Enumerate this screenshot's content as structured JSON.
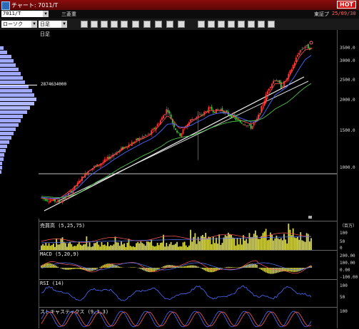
{
  "window": {
    "title": "チャート: 7011/T",
    "hot_badge": "HOT"
  },
  "stock": {
    "code": "7011/T",
    "name": "三菱重",
    "market": "東証プ",
    "date": "25/09/30"
  },
  "toolbar": {
    "chart_style": "ローソク",
    "period": "日足",
    "icons": [
      "zoom-icon",
      "list-icon",
      "print-icon",
      "draw-icon",
      "save-icon",
      "settings-icon",
      "grid-icon",
      "window-icon",
      "arrow-left-icon",
      "cross-icon",
      "tool1-icon",
      "tool2-icon",
      "tool3-icon",
      "tool4-icon",
      "tool5-icon",
      "tool6-icon",
      "tool7-icon",
      "tool8-icon"
    ]
  },
  "main": {
    "period_label": "日足",
    "volume_profile_marker": "2874634000"
  },
  "axis": {
    "main": [
      "3500.0",
      "3000.0",
      "2500.0",
      "2000.0",
      "1500.0",
      "1000.0"
    ],
    "volume": [
      "100",
      "50",
      "0"
    ],
    "macd": [
      "200.00",
      "100.00",
      "0.00",
      "-100.00"
    ],
    "rsi": [
      "100",
      "50"
    ],
    "stoch": [
      "100"
    ]
  },
  "unit": "（百万）",
  "panels": {
    "volume": {
      "label": "売買高 (5,25,75)"
    },
    "macd": {
      "label": "MACD (5,20,9)"
    },
    "rsi": {
      "label": "RSI (14)"
    },
    "stoch": {
      "label": "ストキャスティクス (9,3,3)"
    }
  },
  "chart_data": {
    "type": "candlestick",
    "period": "daily",
    "ylim": [
      500,
      3700
    ],
    "close_approx": [
      750,
      720,
      700,
      680,
      760,
      880,
      1000,
      1150,
      1280,
      1330,
      1380,
      1470,
      1560,
      1620,
      1700,
      1750,
      1820,
      1880,
      1920,
      2050,
      2200,
      2400,
      2100,
      1900,
      2050,
      2200,
      2250,
      2300,
      2400,
      2350,
      2380,
      2300,
      2250,
      2150,
      2120,
      2050,
      2200,
      2500,
      2800,
      2950,
      2800,
      2950,
      3200,
      3450,
      3550,
      3500
    ],
    "series": [
      {
        "values": [
          750,
          730,
          720,
          740,
          820,
          900,
          1000,
          1130,
          1250,
          1320,
          1380,
          1450,
          1530,
          1600,
          1680,
          1730,
          1800,
          1850,
          1900,
          2000,
          2130,
          2270,
          2180,
          2030,
          2060,
          2150,
          2220,
          2280,
          2360,
          2360,
          2370,
          2320,
          2270,
          2190,
          2150,
          2110,
          2180,
          2400,
          2680,
          2860,
          2850,
          2920,
          3120,
          3350,
          3480,
          3500
        ]
      },
      {
        "values": [
          760,
          750,
          740,
          745,
          790,
          850,
          930,
          1040,
          1150,
          1230,
          1300,
          1370,
          1450,
          1520,
          1590,
          1650,
          1710,
          1770,
          1820,
          1890,
          1990,
          2110,
          2120,
          2060,
          2050,
          2090,
          2150,
          2200,
          2270,
          2300,
          2320,
          2310,
          2280,
          2230,
          2190,
          2150,
          2160,
          2280,
          2470,
          2650,
          2720,
          2800,
          2950,
          3130,
          3300,
          3380
        ]
      },
      {
        "values": [
          780,
          770,
          760,
          755,
          765,
          790,
          830,
          890,
          960,
          1030,
          1090,
          1150,
          1220,
          1290,
          1350,
          1410,
          1470,
          1530,
          1580,
          1640,
          1700,
          1780,
          1830,
          1860,
          1880,
          1900,
          1940,
          1980,
          2030,
          2070,
          2110,
          2140,
          2160,
          2170,
          2170,
          2170,
          2180,
          2220,
          2300,
          2390,
          2450,
          2510,
          2600,
          2700,
          2790,
          2860
        ]
      }
    ],
    "volume_profile": [
      3,
      6,
      10,
      12,
      14,
      16,
      18,
      20,
      22,
      25,
      28,
      30,
      32,
      30,
      26,
      24,
      20,
      18,
      16,
      14,
      12,
      10,
      8,
      6,
      5,
      4,
      3,
      2,
      2,
      1
    ]
  }
}
